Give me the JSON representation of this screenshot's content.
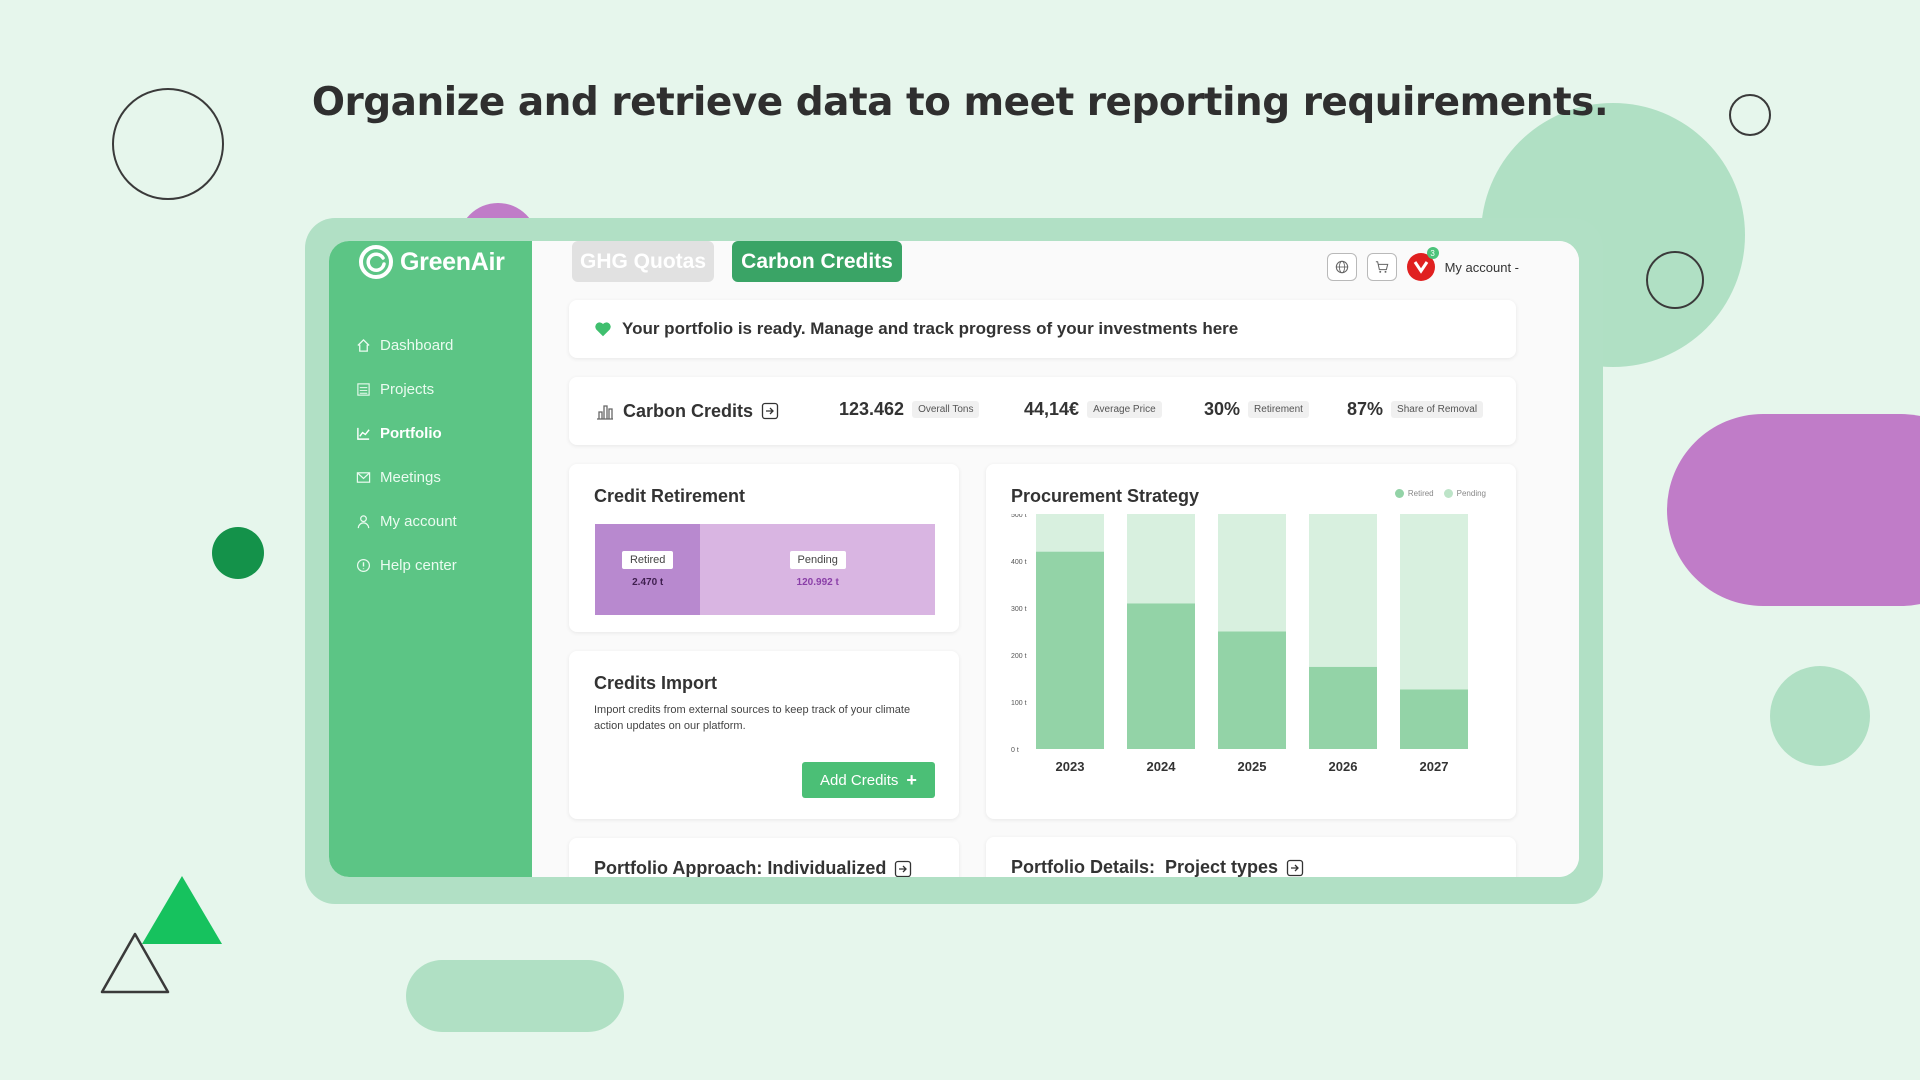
{
  "headline": "Organize and retrieve data to meet reporting requirements.",
  "brand": {
    "name": "GreenAir"
  },
  "sidebar": {
    "items": [
      {
        "label": "Dashboard",
        "icon": "home-icon",
        "active": false
      },
      {
        "label": "Projects",
        "icon": "list-icon",
        "active": false
      },
      {
        "label": "Portfolio",
        "icon": "chart-icon",
        "active": true
      },
      {
        "label": "Meetings",
        "icon": "mail-icon",
        "active": false
      },
      {
        "label": "My account",
        "icon": "user-icon",
        "active": false
      },
      {
        "label": "Help center",
        "icon": "info-icon",
        "active": false
      }
    ]
  },
  "tabs": [
    {
      "label": "GHG Quotas",
      "active": false
    },
    {
      "label": "Carbon Credits",
      "active": true
    }
  ],
  "header": {
    "account_label": "My account -",
    "notification_count": "3"
  },
  "banner": {
    "text": "Your portfolio is ready. Manage and track progress of your investments here"
  },
  "stats": {
    "title": "Carbon Credits",
    "items": [
      {
        "value": "123.462",
        "label": "Overall Tons"
      },
      {
        "value": "44,14€",
        "label": "Average Price"
      },
      {
        "value": "30%",
        "label": "Retirement"
      },
      {
        "value": "87%",
        "label": "Share of Removal"
      }
    ]
  },
  "credit_retirement": {
    "title": "Credit Retirement",
    "retired": {
      "label": "Retired",
      "value": "2.470 t",
      "share": 0.31
    },
    "pending": {
      "label": "Pending",
      "value": "120.992 t",
      "share": 0.69
    }
  },
  "credits_import": {
    "title": "Credits Import",
    "description": "Import credits from external sources to keep track of your climate action updates on our platform.",
    "button_label": "Add Credits"
  },
  "procurement": {
    "title": "Procurement Strategy",
    "legend": [
      "Retired",
      "Pending"
    ]
  },
  "portfolio_approach": {
    "title": "Portfolio Approach: Individualized"
  },
  "portfolio_details": {
    "title": "Portfolio Details:  Project types"
  },
  "colors": {
    "brand_green": "#5cc585",
    "tab_active": "#3aa466",
    "retired_purple": "#b889cf",
    "pending_purple": "#d9b5e2",
    "bar_retired": "#93d3a7",
    "bar_pending": "#d8f0df"
  },
  "chart_data": {
    "type": "bar",
    "title": "Procurement Strategy",
    "categories": [
      "2023",
      "2024",
      "2025",
      "2026",
      "2027"
    ],
    "y_ticks": [
      "0 t",
      "100 t",
      "200 t",
      "300 t",
      "400 t",
      "500 t"
    ],
    "ylim": [
      0,
      500
    ],
    "stacked": true,
    "series": [
      {
        "name": "Retired",
        "values": [
          420,
          310,
          250,
          175,
          127
        ]
      },
      {
        "name": "Pending",
        "values": [
          80,
          190,
          250,
          325,
          373
        ]
      }
    ]
  }
}
